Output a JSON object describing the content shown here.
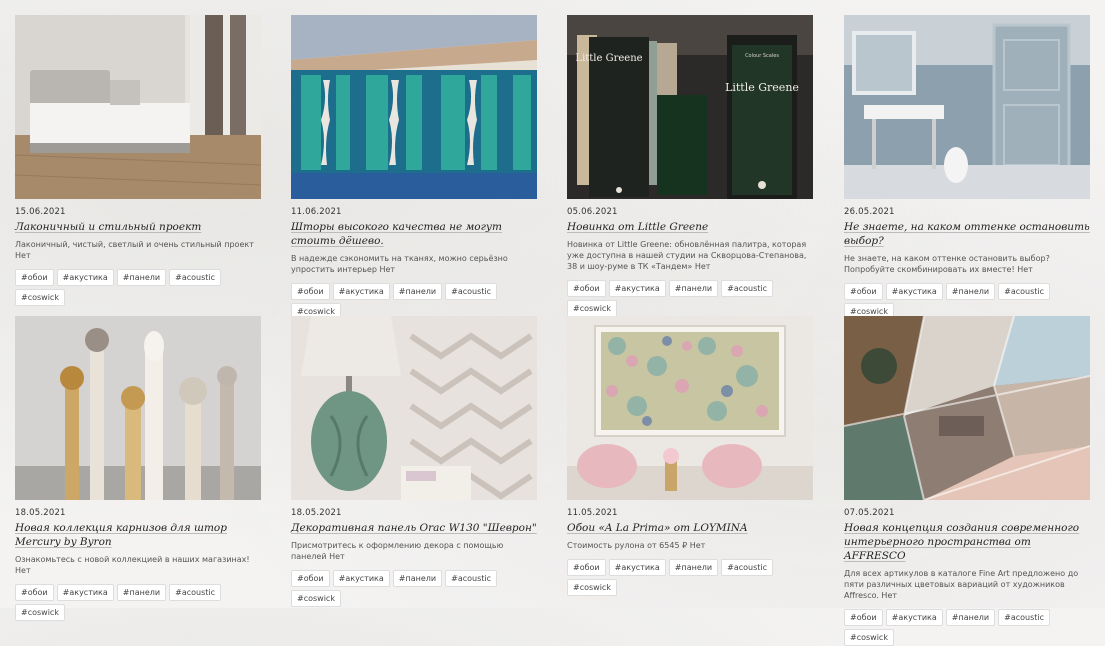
{
  "articles": [
    {
      "date": "15.06.2021",
      "title": "Лаконичный и стильный проект",
      "desc": "Лаконичный, чистый, светлый и очень стильный проект Нет",
      "tags": [
        "#обои",
        "#акустика",
        "#панели",
        "#acoustic",
        "#coswick"
      ]
    },
    {
      "date": "11.06.2021",
      "title": "Шторы высокого качества не могут стоить дёшево.",
      "desc": "В надежде сэкономить на тканях, можно серьёзно упростить интерьер Нет",
      "tags": [
        "#обои",
        "#акустика",
        "#панели",
        "#acoustic",
        "#coswick"
      ]
    },
    {
      "date": "05.06.2021",
      "title": "Новинка от Little Greene",
      "desc": "Новинка от Little Greene: обновлённая палитра, которая уже доступна в нашей студии на Скворцова-Степанова, 38 и шоу-руме в ТК «Тандем» Нет",
      "tags": [
        "#обои",
        "#акустика",
        "#панели",
        "#acoustic",
        "#coswick"
      ]
    },
    {
      "date": "26.05.2021",
      "title": "Не знаете, на каком оттенке остановить выбор?",
      "desc": "Не знаете, на каком оттенке остановить выбор? Попробуйте скомбинировать их вместе! Нет",
      "tags": [
        "#обои",
        "#акустика",
        "#панели",
        "#acoustic",
        "#coswick"
      ]
    },
    {
      "date": "18.05.2021",
      "title": "Новая коллекция карнизов для штор Mercury by Byron",
      "desc": "Ознакомьтесь с новой коллекцией в наших магазинах! Нет",
      "tags": [
        "#обои",
        "#акустика",
        "#панели",
        "#acoustic",
        "#coswick"
      ]
    },
    {
      "date": "18.05.2021",
      "title": "Декоративная панель Orac W130 \"Шеврон\"",
      "desc": "Присмотритесь к оформлению декора с помощью панелей Нет",
      "tags": [
        "#обои",
        "#акустика",
        "#панели",
        "#acoustic",
        "#coswick"
      ]
    },
    {
      "date": "11.05.2021",
      "title": "Обои «A La Prima» от LOYMINA",
      "desc": "Стоимость рулона от 6545 ₽ Нет",
      "tags": [
        "#обои",
        "#акустика",
        "#панели",
        "#acoustic",
        "#coswick"
      ]
    },
    {
      "date": "07.05.2021",
      "title": "Новая концепция создания современного интерьерного пространства от AFFRESCO",
      "desc": "Для всех артикулов в каталоге Fine Art предложено до пяти различных цветовых вариаций от художников Affresco. Нет",
      "tags": [
        "#обои",
        "#акустика",
        "#панели",
        "#acoustic",
        "#coswick"
      ]
    }
  ],
  "images": {
    "img0": "bedroom-photo",
    "img1": "fabric-samples-photo",
    "img2": "little-greene-catalog-photo",
    "img3": "bathroom-photo",
    "img4": "curtain-rods-photo",
    "img5": "chevron-panel-photo",
    "img6": "floral-wallpaper-photo",
    "img7": "affresco-collage-photo"
  },
  "brand_text": {
    "little_greene": "Little Greene",
    "colour_scales": "Colour Scales"
  }
}
